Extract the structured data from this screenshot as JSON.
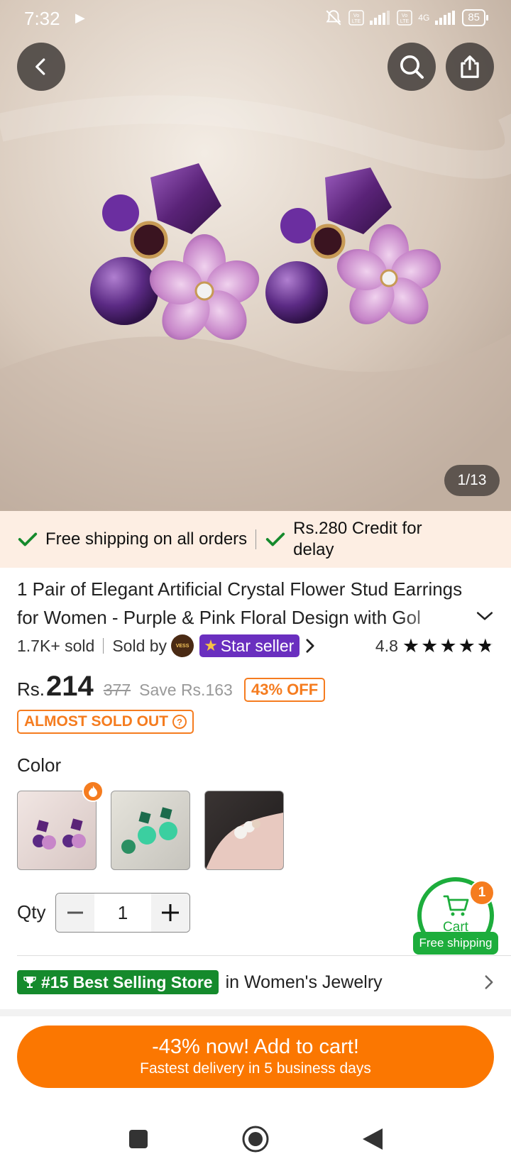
{
  "status_bar": {
    "time": "7:32",
    "battery": "85",
    "network": "4G"
  },
  "gallery": {
    "counter": "1/13"
  },
  "shipping": {
    "free_shipping": "Free shipping on all orders",
    "credit": "Rs.280 Credit for delay"
  },
  "product": {
    "title": "1 Pair of Elegant Artificial Crystal Flower Stud Earrings for Women - Purple & Pink Floral Design with Gol",
    "sold": "1.7K+ sold",
    "sold_by_label": "Sold by",
    "seller_logo_text": "VESS",
    "star_seller": "Star seller",
    "rating": "4.8",
    "stars": 4.8
  },
  "price": {
    "currency": "Rs.",
    "current": "214",
    "original": "377",
    "save": "Save Rs.163",
    "discount": "43% OFF",
    "stock_warning": "ALMOST SOLD OUT"
  },
  "color": {
    "label": "Color",
    "options": [
      {
        "name": "Purple",
        "selected": true
      },
      {
        "name": "Green",
        "selected": false
      },
      {
        "name": "White",
        "selected": false
      }
    ]
  },
  "quantity": {
    "label": "Qty",
    "value": "1"
  },
  "cart": {
    "label": "Cart",
    "count": "1",
    "free_shipping": "Free shipping"
  },
  "store": {
    "badge": "#15 Best Selling Store",
    "category": "in Women's Jewelry"
  },
  "add_to_cart": {
    "main": "-43% now! Add to cart!",
    "sub": "Fastest delivery in 5 business days"
  },
  "colors": {
    "accent": "#fb7701",
    "green": "#1dad3c",
    "purple": "#6a2fbf"
  }
}
